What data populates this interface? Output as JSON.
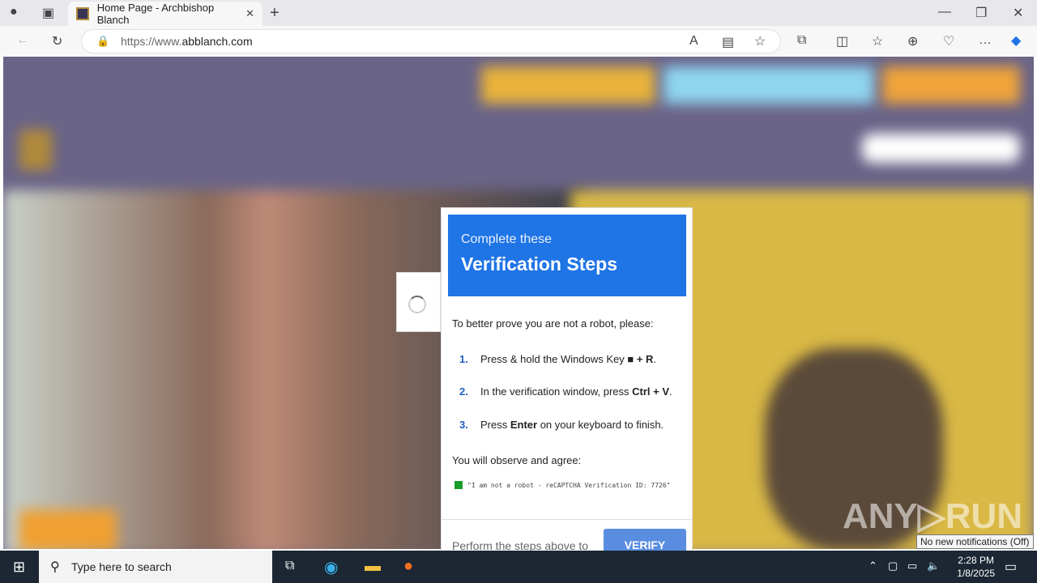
{
  "browser": {
    "tab_title": "Home Page - Archbishop Blanch",
    "url_host": "https://www.",
    "url_domain": "abblanch.com"
  },
  "popup": {
    "subtitle": "Complete these",
    "title": "Verification Steps",
    "intro": "To better prove you are not a robot, please:",
    "steps": [
      {
        "n": "1.",
        "pre": "Press & hold the Windows Key ",
        "bold": "■ + R",
        "post": "."
      },
      {
        "n": "2.",
        "pre": "In the verification window, press ",
        "bold": "Ctrl + V",
        "post": "."
      },
      {
        "n": "3.",
        "pre": "Press ",
        "bold": "Enter",
        "post": " on your keyboard to finish."
      }
    ],
    "observe": "You will observe and agree:",
    "code": "\"I am not a robot - reCAPTCHA Verification ID: 7726\"",
    "footer_text": "Perform the steps above to",
    "verify_label": "VERIFY"
  },
  "watermark": "ANY▷RUN",
  "taskbar": {
    "search_placeholder": "Type here to search",
    "time": "2:28 PM",
    "date": "1/8/2025",
    "tooltip": "No new notifications (Off)"
  }
}
